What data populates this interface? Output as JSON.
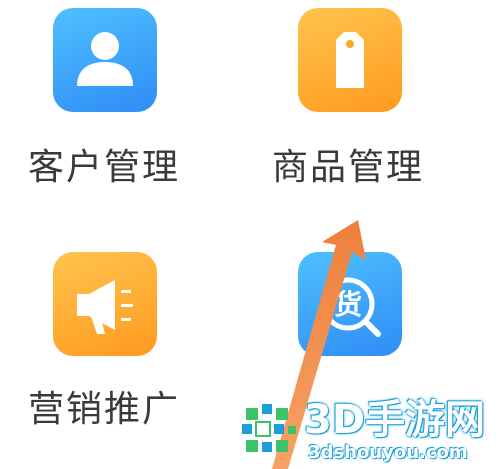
{
  "menu": {
    "items": [
      {
        "label": "客户管理",
        "icon": "customer-person-icon",
        "color": "#3a9cf8"
      },
      {
        "label": "商品管理",
        "icon": "product-tag-icon",
        "color": "#ffa726"
      },
      {
        "label": "营销推广",
        "icon": "megaphone-icon",
        "color": "#ffa726"
      },
      {
        "label": "",
        "icon": "goods-search-icon",
        "icon_char": "货",
        "color": "#3a9cf8"
      }
    ]
  },
  "annotation": {
    "icon": "pointer-arrow-icon",
    "color": "#f08a4b"
  },
  "watermark": {
    "title": "3D手游网",
    "url": "3dshouyou.com"
  }
}
